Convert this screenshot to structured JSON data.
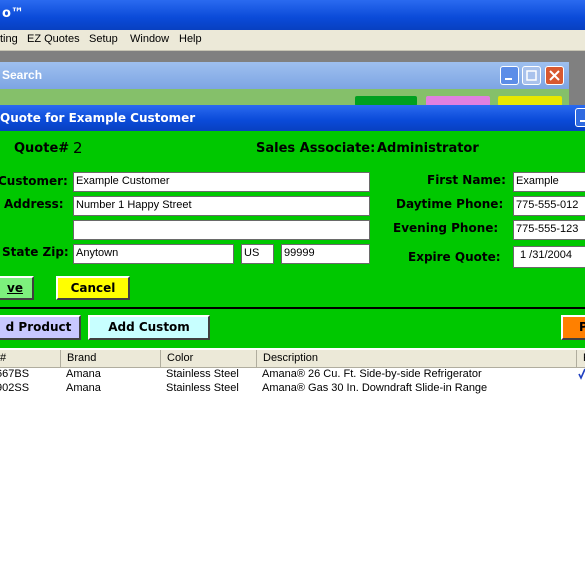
{
  "app": {
    "title": "o™"
  },
  "menu": {
    "items": [
      "ting",
      "EZ Quotes",
      "Setup",
      "Window",
      "Help"
    ]
  },
  "search_window": {
    "title": "Search"
  },
  "quote_window": {
    "title": "Quote for Example Customer",
    "quote_label": "Quote#",
    "quote_number": "2",
    "sales_label": "Sales Associate:",
    "sales_value": "Administrator",
    "labels": {
      "customer": "Customer:",
      "address": "Address:",
      "state_zip": "State Zip:",
      "first_name": "First Name:",
      "daytime_phone": "Daytime Phone:",
      "evening_phone": "Evening Phone:",
      "expire_quote": "Expire Quote:"
    },
    "fields": {
      "customer": "Example Customer",
      "address1": "Number 1 Happy Street",
      "address2": "",
      "city": "Anytown",
      "state": "US",
      "zip": "99999",
      "first_name": "Example",
      "daytime_phone": "775-555-012",
      "evening_phone": "775-555-123",
      "expire_quote": "1 /31/2004"
    },
    "buttons": {
      "save": "ve",
      "cancel": "Cancel",
      "add_product": "d Product",
      "add_custom": "Add Custom",
      "right": "P"
    }
  },
  "table": {
    "columns": [
      "#",
      "Brand",
      "Color",
      "Description",
      "P"
    ],
    "rows": [
      {
        "num": "667BS",
        "brand": "Amana",
        "color": "Stainless Steel",
        "description": "Amana® 26 Cu. Ft. Side-by-side Refrigerator"
      },
      {
        "num": "902SS",
        "brand": "Amana",
        "color": "Stainless Steel",
        "description": "Amana® Gas 30 In. Downdraft Slide-in Range"
      }
    ]
  },
  "colors": {
    "titlebar": "#0a4ad8",
    "form_bg": "#00c800",
    "save_btn": "#7df07d",
    "cancel_btn": "#ffff00",
    "add_product_btn": "#c8c8ff",
    "add_custom_btn": "#c8ffff",
    "right_btn": "#ff8000"
  }
}
